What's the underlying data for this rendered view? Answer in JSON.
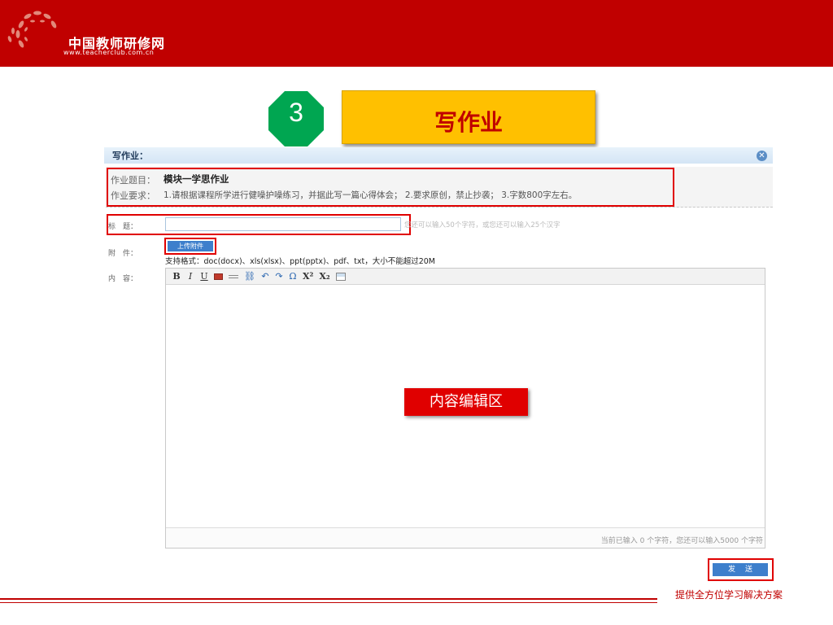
{
  "header": {
    "site_name": "中国教师研修网",
    "site_url": "www.teacherclub.com.cn",
    "brand_color": "#c00000"
  },
  "step": {
    "number": "3",
    "title": "写作业",
    "badge_color": "#00a651",
    "box_color": "#ffc000"
  },
  "form": {
    "panel_title": "写作业：",
    "close_icon": "close-icon",
    "assignment_title_label": "作业题目：",
    "assignment_title_value": "模块一学思作业",
    "requirements_label": "作业要求：",
    "requirements_value": "1.请根据课程所学进行健噪护噪练习，并据此写一篇心得体会； 2.要求原创，禁止抄袭； 3.字数800字左右。",
    "title_label": "标　题：",
    "title_value": "",
    "title_hint": "您还可以输入50个字符，或您还可以输入25个汉字",
    "attachment_label": "附　件：",
    "upload_button": "上传附件",
    "supported_formats": "支持格式：doc(docx)、xls(xlsx)、ppt(pptx)、pdf、txt，大小不能超过20M",
    "content_label": "内　容："
  },
  "editor": {
    "toolbar": [
      {
        "name": "bold-button",
        "label": "B"
      },
      {
        "name": "italic-button",
        "label": "I"
      },
      {
        "name": "underline-button",
        "label": "U"
      },
      {
        "name": "insert-image-button",
        "label": ""
      },
      {
        "name": "horizontal-rule-button",
        "label": ""
      },
      {
        "name": "link-button",
        "label": "⛓"
      },
      {
        "name": "undo-button",
        "label": "↶"
      },
      {
        "name": "redo-button",
        "label": "↷"
      },
      {
        "name": "special-char-button",
        "label": "Ω"
      },
      {
        "name": "superscript-button",
        "label": "X²"
      },
      {
        "name": "subscript-button",
        "label": "X₂"
      },
      {
        "name": "insert-table-button",
        "label": ""
      }
    ],
    "content_area_callout": "内容编辑区",
    "status_text": "当前已输入 0 个字符，您还可以输入5000 个字符"
  },
  "actions": {
    "send_button": "发送"
  },
  "footer": {
    "slogan": "提供全方位学习解决方案"
  }
}
